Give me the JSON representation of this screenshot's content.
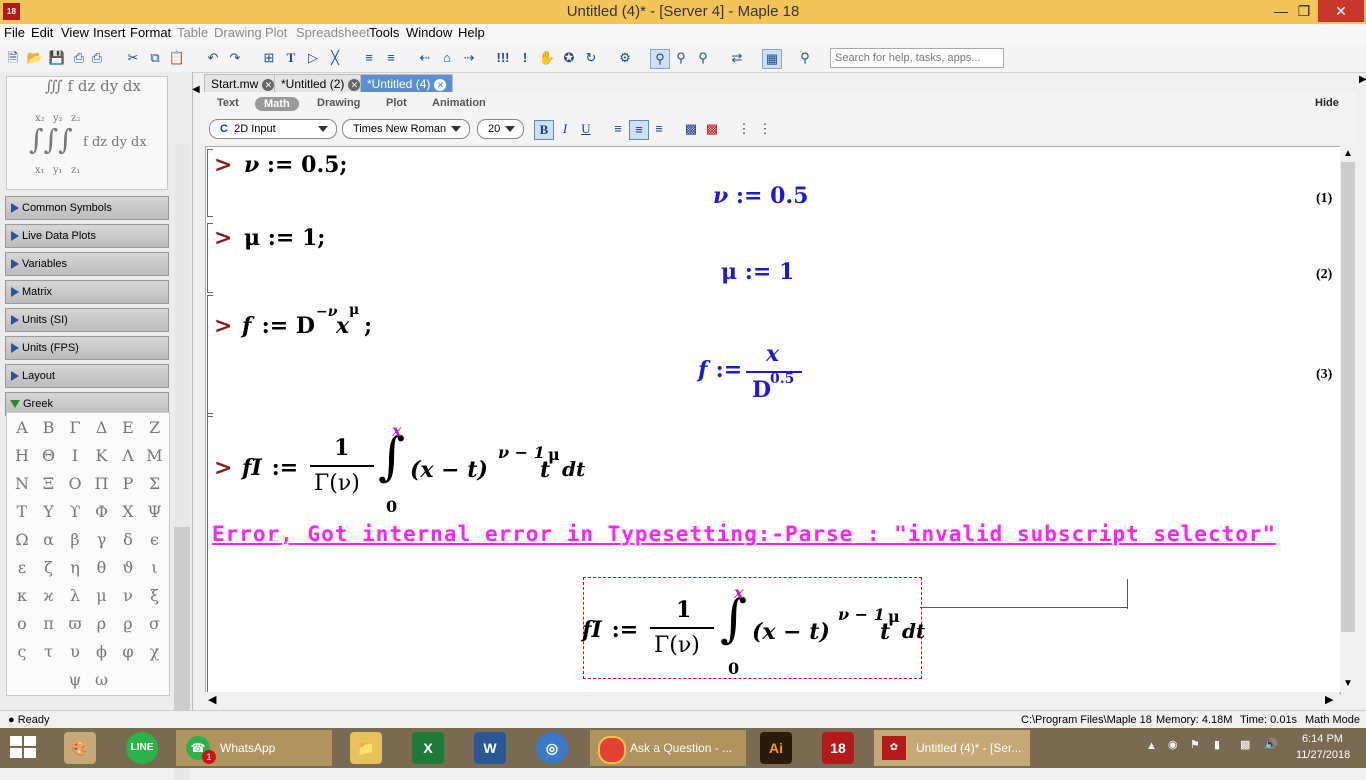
{
  "window": {
    "title": "Untitled (4)* - [Server 4] - Maple 18",
    "app_icon": "18"
  },
  "menu": [
    "File",
    "Edit",
    "View",
    "Insert",
    "Format",
    "Table",
    "Drawing",
    "Plot",
    "Spreadsheet",
    "Tools",
    "Window",
    "Help"
  ],
  "menu_disabled": [
    "Table",
    "Drawing",
    "Plot",
    "Spreadsheet"
  ],
  "search": {
    "placeholder": "Search for help, tasks, apps..."
  },
  "palette": {
    "integral_preview": {
      "line1": "∭ f dz dy dx",
      "line2": "f dz dy dx",
      "x1": "x₁",
      "x2": "x₂",
      "y1": "y₁",
      "y2": "y₂",
      "z1": "z₁",
      "z2": "z₂"
    },
    "sections": [
      "Common Symbols",
      "Live Data Plots",
      "Variables",
      "Matrix",
      "Units (SI)",
      "Units (FPS)",
      "Layout",
      "Greek"
    ],
    "greek": [
      "Α",
      "Β",
      "Γ",
      "Δ",
      "Ε",
      "Ζ",
      "Η",
      "Θ",
      "Ι",
      "Κ",
      "Λ",
      "Μ",
      "Ν",
      "Ξ",
      "Ο",
      "Π",
      "Ρ",
      "Σ",
      "Τ",
      "Υ",
      "ϒ",
      "Φ",
      "Χ",
      "Ψ",
      "Ω",
      "α",
      "β",
      "γ",
      "δ",
      "ϵ",
      "ε",
      "ζ",
      "η",
      "θ",
      "ϑ",
      "ι",
      "κ",
      "ϰ",
      "λ",
      "μ",
      "ν",
      "ξ",
      "ο",
      "π",
      "ϖ",
      "ρ",
      "ϱ",
      "σ",
      "ς",
      "τ",
      "υ",
      "ϕ",
      "φ",
      "χ",
      "ψ",
      "ω"
    ]
  },
  "tabs": [
    {
      "label": "Start.mw",
      "active": false
    },
    {
      "label": "*Untitled (2)",
      "active": false
    },
    {
      "label": "*Untitled (4)",
      "active": true
    }
  ],
  "context": {
    "modes": [
      "Text",
      "Math",
      "Drawing",
      "Plot",
      "Animation"
    ],
    "active_mode": "Math",
    "hide": "Hide",
    "input_mode": "2D Input",
    "input_mode_icon": "C",
    "font": "Times New Roman",
    "size": "20",
    "bold": "B",
    "italic": "I",
    "underline": "U"
  },
  "worksheet": {
    "prompt": ">",
    "in1": {
      "var": "ν",
      "assign": " := 0.5;"
    },
    "out1": {
      "var": "ν",
      "assign": " := 0.5",
      "label": "(1)"
    },
    "in2": {
      "text": "μ := 1;"
    },
    "out2": {
      "text": "μ := 1",
      "label": "(2)"
    },
    "in3": {
      "f": "f",
      "assign": " := D",
      "exp1": "−ν",
      "x": "x",
      "exp2": "μ",
      "end": ";"
    },
    "out3": {
      "f": "f",
      "assign": " := ",
      "num": "x",
      "den": "D",
      "den_exp": "0.5",
      "label": "(3)"
    },
    "in4": {
      "name": "fI",
      "assign": " := ",
      "num": "1",
      "den": "Γ(ν)",
      "upper": "x",
      "lower": "0",
      "body": "(x − t)",
      "exp": "ν − 1",
      "t": "t",
      "texp": "μ",
      "dt": "dt"
    },
    "error": "Error, Got internal error in Typesetting:-Parse : \"invalid subscript selector\"",
    "out4": {
      "name": "fI",
      "assign": " := ",
      "num": "1",
      "den": "Γ(ν)",
      "upper": "x",
      "lower": "0",
      "body": "(x − t)",
      "exp": "ν − 1",
      "t": "t",
      "texp": "μ",
      "dt": "dt"
    }
  },
  "status": {
    "left": "● Ready",
    "path": "C:\\Program Files\\Maple 18",
    "memory": "Memory: 4.18M",
    "time": "Time: 0.01s",
    "mode": "Math Mode"
  },
  "taskbar": {
    "items": [
      {
        "label": "WhatsApp",
        "badge": "1"
      },
      {
        "label": "Ask a Question - ..."
      },
      {
        "label": "Untitled (4)* - [Ser..."
      }
    ],
    "icons": {
      "line": "LINE",
      "excel": "X",
      "word": "W",
      "illustrator": "Ai",
      "maple": "18"
    },
    "clock_time": "6:14 PM",
    "clock_date": "11/27/2018"
  },
  "colors": {
    "titlebar": "#f2c45a",
    "input": "#000000",
    "output": "#1b1bd6",
    "prompt": "#8b1a1a",
    "error": "#ff20ff",
    "accent": "#5a8fd0"
  }
}
